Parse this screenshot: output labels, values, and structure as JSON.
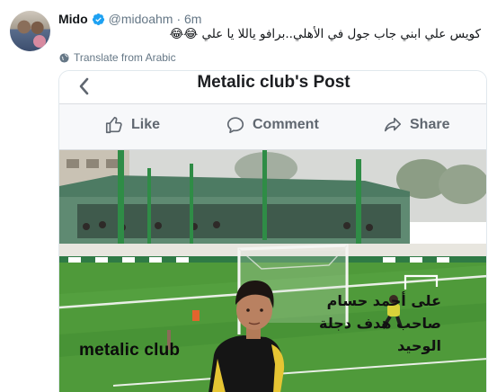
{
  "tweet": {
    "author_name": "Mido",
    "handle": "@midoahm",
    "time": "· 6m",
    "text": "كويس علي ابني جاب جول في الأهلي..برافو ياللا يا علي 😂😂",
    "translate_label": "Translate from Arabic"
  },
  "media": {
    "title": "Metalic club's Post",
    "actions": [
      "Like",
      "Comment",
      "Share"
    ],
    "caption_en": "metalic club",
    "caption_ar_lines": [
      "على أحمد حسام",
      "صاحب هدف دجلة",
      "الوحيد"
    ]
  },
  "colors": {
    "verified": "#1da1f2",
    "muted": "#657786",
    "fb_grey": "#606770",
    "pitch": "#4f9a3a"
  },
  "icons": [
    "verified-badge-icon",
    "globe-icon",
    "back-arrow-icon",
    "like-icon",
    "comment-icon",
    "share-icon"
  ]
}
